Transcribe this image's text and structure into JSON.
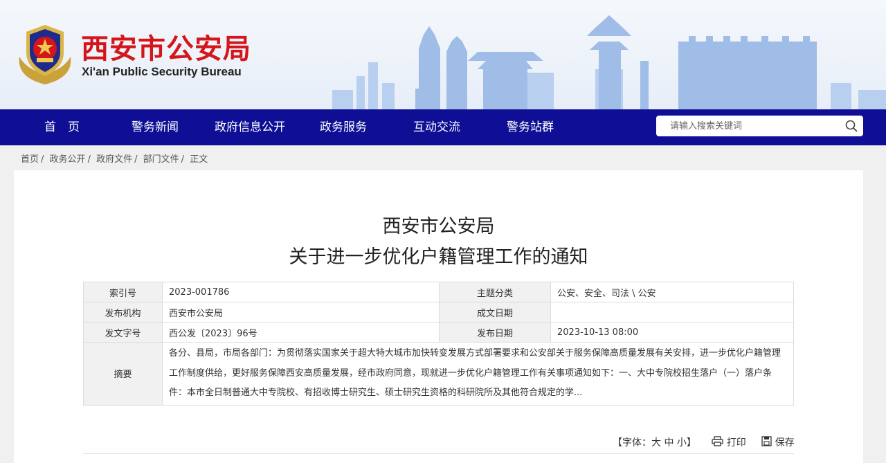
{
  "header": {
    "title": "西安市公安局",
    "subtitle": "Xi'an Public Security Bureau",
    "brand_red": "#d4161b",
    "skyline_color": "#9fbde6"
  },
  "nav": {
    "items": [
      "首　页",
      "警务新闻",
      "政府信息公开",
      "政务服务",
      "互动交流",
      "警务站群"
    ],
    "bg": "#0e0f95"
  },
  "search": {
    "placeholder": "请输入搜索关键词",
    "icon": "search-icon"
  },
  "breadcrumb": [
    "首页",
    "政务公开",
    "政府文件",
    "部门文件",
    "正文"
  ],
  "document": {
    "title_line1": "西安市公安局",
    "title_line2": "关于进一步优化户籍管理工作的通知"
  },
  "meta": {
    "index_label": "索引号",
    "index_value": "2023-001786",
    "topic_label": "主题分类",
    "topic_value": "公安、安全、司法 \\ 公安",
    "org_label": "发布机构",
    "org_value": "西安市公安局",
    "written_label": "成文日期",
    "written_value": "",
    "docno_label": "发文字号",
    "docno_value": "西公发〔2023〕96号",
    "pubdate_label": "发布日期",
    "pubdate_value": "2023-10-13 08:00",
    "abstract_label": "摘要",
    "abstract_value": "各分、县局，市局各部门：为贯彻落实国家关于超大特大城市加快转变发展方式部署要求和公安部关于服务保障高质量发展有关安排，进一步优化户籍管理工作制度供给，更好服务保障西安高质量发展，经市政府同意，现就进一步优化户籍管理工作有关事项通知如下：一、大中专院校招生落户（一）落户条件：本市全日制普通大中专院校、有招收博士研究生、硕士研究生资格的科研院所及其他符合规定的学..."
  },
  "tools": {
    "font_open": "【字体：",
    "font_large": "大",
    "font_medium": "中",
    "font_small": "小",
    "font_close": "】",
    "print": "打印",
    "print_icon": "printer-icon",
    "save": "保存",
    "save_icon": "save-icon"
  }
}
